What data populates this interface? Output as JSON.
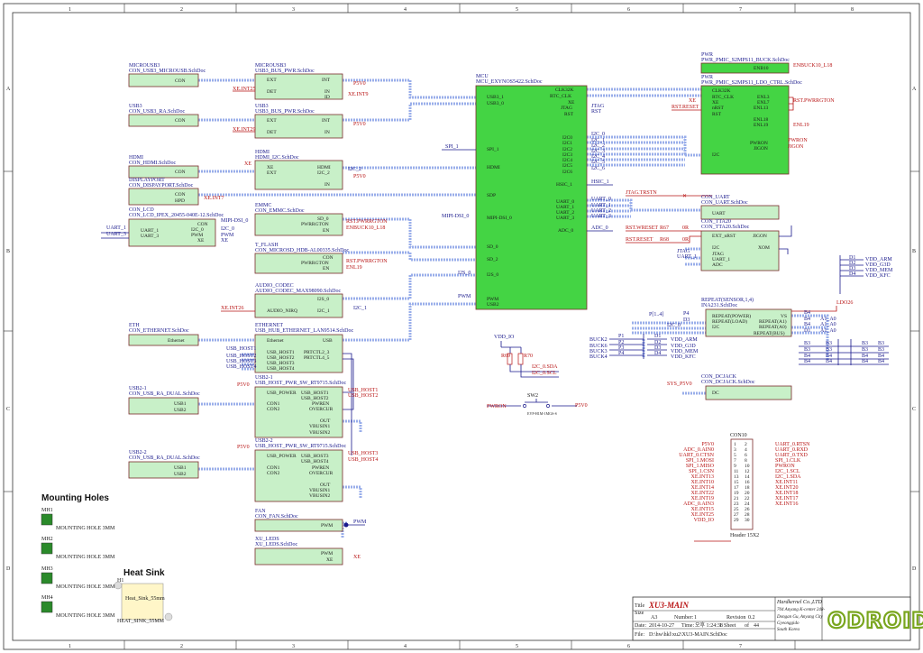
{
  "border": {
    "cols": [
      "1",
      "2",
      "3",
      "4",
      "5",
      "6",
      "7",
      "8"
    ],
    "rows": [
      "A",
      "B",
      "C",
      "D"
    ]
  },
  "sheets": {
    "microusb": {
      "title1": "MICROUSB3",
      "title2": "CON_USB3_MICROUSB.SchDoc",
      "pins": [
        "CON"
      ]
    },
    "microusb_bus": {
      "title1": "MICROUSB3",
      "title2": "USB3_BUS_PWR.SchDoc",
      "left": [
        "EXT",
        "DET"
      ],
      "right": [
        "INT",
        "IN",
        "ID"
      ]
    },
    "usb3": {
      "title1": "USB3",
      "title2": "CON_USB3_RA.SchDoc",
      "pins": [
        "CON"
      ]
    },
    "usb3_bus": {
      "title1": "USB3",
      "title2": "USB3_BUS_PWR.SchDoc",
      "left": [
        "EXT",
        "DET"
      ],
      "right": [
        "INT",
        "IN"
      ]
    },
    "hdmi": {
      "title1": "HDMI",
      "title2": "CON_HDMI.SchDoc",
      "pins": [
        "CON"
      ]
    },
    "hdmi_i2c": {
      "title1": "HDMI",
      "title2": "HDMI_I2C.SchDoc",
      "left": [
        "XE",
        "EXT"
      ],
      "right": [
        "HDMI",
        "I2C_2",
        "IN"
      ]
    },
    "displayport": {
      "title1": "DISPLAYPORT",
      "title2": "CON_DISPAYPORT.SchDoc",
      "pins": [
        "CON",
        "HPD"
      ]
    },
    "lcd": {
      "title1": "CON_LCD",
      "title2": "CON_LCD_IPEX_20455-040E-12.SchDoc",
      "left": [
        "UART_1",
        "UART_3"
      ],
      "right": [
        "CON",
        "I2C_0",
        "PWM",
        "XE"
      ]
    },
    "emmc": {
      "title1": "EMMC",
      "title2": "CON_EMMC.SchDoc",
      "pins": [
        "SD_0",
        "PWRRGTON",
        "EN"
      ]
    },
    "tflash": {
      "title1": "T_FLASH",
      "title2": "CON_MICROSD_HDB-AL00335.SchDoc",
      "pins": [
        "CON",
        "PWRRGTON",
        "EN"
      ]
    },
    "audio": {
      "title1": "AUDIO_CODEC",
      "title2": "AUDIO_CODEC_MAX98090.SchDoc",
      "pins": [
        "I2S_0",
        "AUDIO_NIRQ",
        "I2C_1"
      ]
    },
    "eth": {
      "title1": "ETH",
      "title2": "CON_ETHERNET.SchDoc",
      "pins": [
        "Ethernet"
      ]
    },
    "ethernet": {
      "title1": "ETHERNET",
      "title2": "USB_HUB_ETHERNET_LAN9514.SchDoc",
      "left": [
        "Ethernet",
        "USB_HOST1",
        "USB_HOST2",
        "USB_HOST3",
        "USB_HOST4"
      ],
      "right": [
        "USB",
        "PRTCTL2_3",
        "PRTCTL4_5"
      ]
    },
    "usb2_1": {
      "title1": "USB2-1",
      "title2": "CON_USB_RA_DUAL.SchDoc",
      "pins": [
        "USB1",
        "USB2"
      ]
    },
    "usb2_1_pwr": {
      "title1": "USB2-1",
      "title2": "USB_HOST_PWR_SW_RT9715.SchDoc",
      "left": [
        "USB_POWER",
        "CON1",
        "CON2"
      ],
      "right": [
        "USB_HOST1",
        "USB_HOST2",
        "PWREN",
        "OVERCUR",
        "OUT",
        "VBUSIN1",
        "VBUSIN2"
      ]
    },
    "usb2_2": {
      "title1": "USB2-2",
      "title2": "CON_USB_RA_DUAL.SchDoc",
      "pins": [
        "USB1",
        "USB2"
      ]
    },
    "usb2_2_pwr": {
      "title1": "USB2-2",
      "title2": "USB_HOST_PWR_SW_RT9715.SchDoc",
      "left": [
        "USB_POWER",
        "CON1",
        "CON2"
      ],
      "right": [
        "USB_HOST3",
        "USB_HOST4",
        "PWREN",
        "OVERCUR",
        "OUT",
        "VBUSIN1",
        "VBUSIN2"
      ]
    },
    "fan": {
      "title1": "FAN",
      "title2": "CON_FAN.SchDoc",
      "pins": [
        "PWM"
      ]
    },
    "leds": {
      "title1": "XU_LEDS",
      "title2": "XU_LEDS.SchDoc",
      "pins": [
        "PWM",
        "XE"
      ]
    },
    "mcu": {
      "title1": "MCU",
      "title2": "MCU_EXYNOS5422.SchDoc",
      "left": [
        "USB3_1",
        "USB3_0",
        "SPI_1",
        "HDMI",
        "SDP",
        "MIPI-DSI_0",
        "SD_0",
        "SD_2",
        "I2S_0",
        "PWM",
        "USB2"
      ],
      "right": [
        "CLK32K",
        "RTC_CLK",
        "XE",
        "JTAG",
        "RST",
        "I2C0",
        "I2C1",
        "I2C2",
        "I2C3",
        "I2C4",
        "I2C5",
        "I2C6",
        "HSIC_1",
        "UART_0",
        "UART_1",
        "UART_2",
        "UART_3",
        "ADC_0"
      ]
    },
    "pwr1": {
      "title1": "PWR",
      "title2": "PWR_PMIC_S2MPS11_BUCK.SchDoc",
      "pins": [
        "ENB10"
      ]
    },
    "pwr2": {
      "title1": "PWR",
      "title2": "PWR_PMIC_S2MPS11_LDO_CTRL.SchDoc",
      "left": [
        "CLK32K",
        "RTC_CLK",
        "XE",
        "nRST",
        "RST",
        "I2C"
      ],
      "right": [
        "ENL3",
        "ENL7",
        "ENL13",
        "ENL18",
        "ENL19",
        "PWRON",
        "JIGON"
      ]
    },
    "uart": {
      "title1": "CON_UART",
      "title2": "CON_UART.SchDoc",
      "pins": [
        "UART"
      ]
    },
    "tta": {
      "title1": "CON_TTA20",
      "title2": "CON_TTA20.SchDoc",
      "left": [
        "EXT_nRST",
        "I2C",
        "JTAG",
        "UART_1",
        "ADC"
      ],
      "right": [
        "JIGON",
        "XOM"
      ]
    },
    "repeat": {
      "title1": "REPEAT(SENSOR,1,4)",
      "title2": "INA231.SchDoc",
      "left": [
        "REPEAT(POWER)",
        "REPEAT(LOAD)",
        "I2C"
      ],
      "right": [
        "VS",
        "REPEAT(A1)",
        "REPEAT(A0)",
        "REPEAT(BUS)"
      ]
    },
    "dcjack": {
      "title1": "CON_DCJACK",
      "title2": "CON_DCJACK.SchDoc",
      "pins": [
        "DC"
      ]
    }
  },
  "nets": {
    "p5v0": "P5V0",
    "xe_int9": "XE.INT9",
    "xe_int25": "XE.INT25",
    "xe_int29": "XE.INT29",
    "xe": "XE",
    "i2c2": "I2C_2",
    "xe_int7": "XE.INT7",
    "uart1": "UART_1",
    "uart3": "UART_3",
    "mipi_dsi0": "MIPI-DSI_0",
    "i2c0": "I2C_0",
    "pwm": "PWM",
    "rst_pwrrgton": "RST.PWRRGTON",
    "enbuck10_l18": "ENBUCK10_L18",
    "enl19": "ENL19",
    "i2s0": "I2S_0",
    "xe_int26": "XE.INT26",
    "i2c1": "I2C_1",
    "usb_host1": "USB_HOST1",
    "usb_host2": "USB_HOST2",
    "usb_host3": "USB_HOST3",
    "usb_host4": "USB_HOST4",
    "spi1": "SPI_1",
    "jtag": "JTAG",
    "rst": "RST",
    "i2c0_lbl": "I2C_0",
    "i2c1_lbl": "I2C_1",
    "i2c3": "I2C_3",
    "i2c4": "I2C_4",
    "i2c5": "I2C_5",
    "i2c6": "I2C_6",
    "hsic1": "HSIC_1",
    "uart0": "UART_0",
    "uart2": "UART_2",
    "adc0": "ADC_0",
    "enbuck10_l18b": "ENBUCK10_L18",
    "rst_pwrrgton2": "RST.PWRRGTON",
    "xe_reset": "RST.RESET",
    "pwron": "PWRON",
    "jigon": "JIGON",
    "jtag_trstn": "JTAG.TRSTN",
    "rst_wreset": "RST.WRESET",
    "r67": "R67",
    "r68": "R68",
    "zero": "0R",
    "adc": "ADC_0",
    "vdd_arm": "VDD_ARM",
    "vdd_g3d": "VDD_G3D",
    "vdd_mem": "VDD_MEM",
    "vdd_kfc": "VDD_KFC",
    "d1": "D1",
    "d2": "D2",
    "d3": "D3",
    "d4": "D4",
    "ldo26": "LDO26",
    "p4": "P4",
    "b4": "B4",
    "b3": "B3",
    "a1_a0": "A1_A0",
    "buck2": "BUCK2",
    "buck6": "BUCK6",
    "buck3": "BUCK3",
    "buck4": "BUCK4",
    "p1": "P1",
    "p2": "P2",
    "p3": "P3",
    "p4b": "P4",
    "vdd_io": "VDD_IO",
    "r69": "R69",
    "r70": "R70",
    "i2c_sda": "I2C_0.SDA",
    "i2c_scl": "I2C_0.SCL",
    "sw2": "SW2",
    "sw2_part": "EVP-H1M-1MGS-S",
    "sys_p5v0": "SYS_P5V0",
    "con10": "CON10",
    "header": "Header 15X2",
    "ptl": "P[1..4]",
    "dtl": "D[1..4]",
    "btl": "B[1..4]"
  },
  "header_pins": {
    "left_labels": [
      "P5V0",
      "ADC_0.AIN0",
      "UART_0.CTSN",
      "SPI_1.MOSI",
      "SPI_1.MISO",
      "SPI_1.CSN",
      "XE.INT13",
      "XE.INT10",
      "XE.INT14",
      "XE.INT22",
      "XE.INT19",
      "ADC_0.AIN3",
      "XE.INT15",
      "XE.INT25",
      "VDD_IO"
    ],
    "right_labels": [
      "UART_0.RTSN",
      "UART_0.RXD",
      "UART_0.TXD",
      "SPI_1.CLK",
      "PWRON",
      "I2C_1.SCL",
      "I2C_1.SDA",
      "XE.INT11",
      "XE.INT20",
      "XE.INT18",
      "XE.INT17",
      "XE.INT16"
    ],
    "numbers_left": [
      "1",
      "3",
      "5",
      "7",
      "9",
      "11",
      "13",
      "15",
      "17",
      "19",
      "21",
      "23",
      "25",
      "27",
      "29"
    ],
    "numbers_right": [
      "2",
      "4",
      "6",
      "8",
      "10",
      "12",
      "14",
      "16",
      "18",
      "20",
      "22",
      "24",
      "26",
      "28",
      "30"
    ]
  },
  "mounting": {
    "title": "Mounting Holes",
    "holes": [
      {
        "ref": "MH1",
        "label": "MOUNTING HOLE 3MM"
      },
      {
        "ref": "MH2",
        "label": "MOUNTING HOLE 3MM"
      },
      {
        "ref": "MH3",
        "label": "MOUNTING HOLE 3MM"
      },
      {
        "ref": "MH4",
        "label": "MOUNTING HOLE 3MM"
      }
    ]
  },
  "heatsink": {
    "title": "Heat Sink",
    "ref": "H1",
    "body": "Heat_Sink_55mm",
    "label": "HEAT_SINK_55MM"
  },
  "title_block": {
    "title_label": "Title",
    "title": "XU3-MAIN",
    "size_label": "Size",
    "size": "A3",
    "number_label": "Number:",
    "number": "1",
    "revision_label": "Revision",
    "revision": "0.2",
    "date_label": "Date:",
    "date": "2014-10-27",
    "time_label": "Time:",
    "time": "오후 1:24:38",
    "sheet_label": "Sheet",
    "sheet": "1",
    "of_label": "of",
    "sheets": "44",
    "file_label": "File:",
    "file": "D:\\hw\\hkl\\xu2\\XU3-MAIN.SchDoc",
    "company": "Hardkernel Co.,LTD",
    "addr1": "704 Anyang K-center 248-25",
    "addr2": "Dongan Gu, Anyang City",
    "addr3": "Gyeonggido",
    "addr4": "South Korea",
    "logo": "ODROID"
  }
}
